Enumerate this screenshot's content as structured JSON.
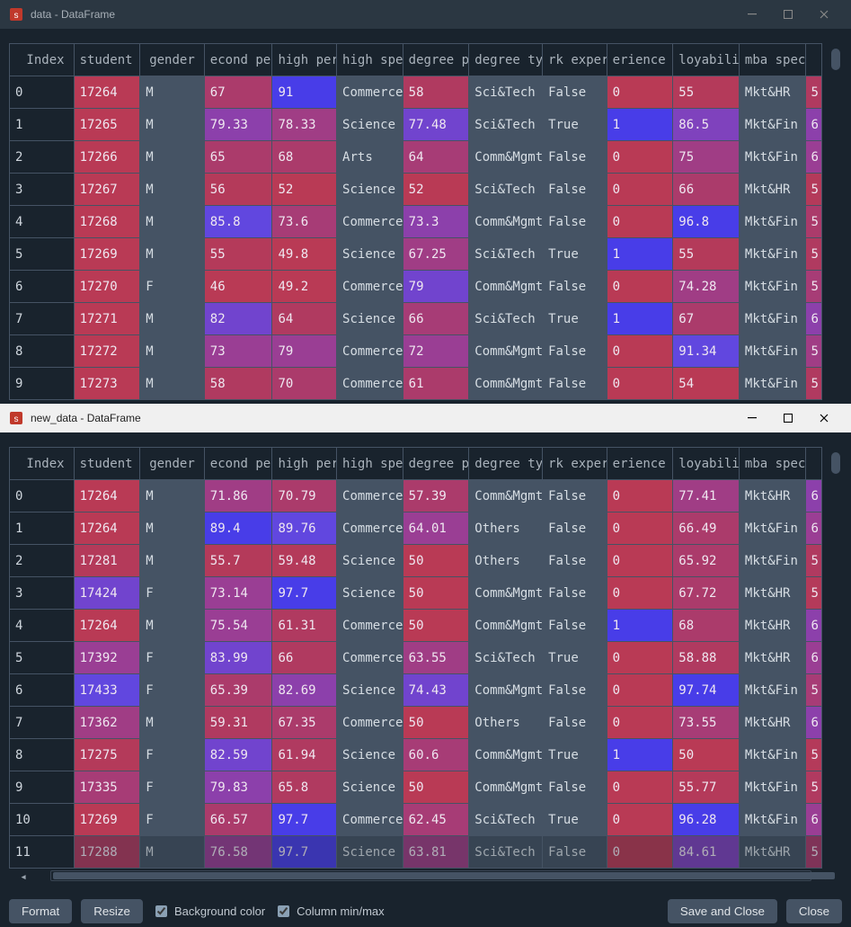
{
  "windows": [
    {
      "title": "data - DataFrame",
      "active": false
    },
    {
      "title": "new_data - DataFrame",
      "active": true
    }
  ],
  "columns": {
    "index": "Index",
    "sid": "student id",
    "gen": "gender",
    "sec": "econd per",
    "hp": "high perc",
    "hs": "high spec",
    "dp": "degree per",
    "dt": "degree type",
    "we": "rk experier",
    "wy": "erience ye",
    "emp": "loyability p",
    "mba": "mba spec",
    "last": ""
  },
  "toolbar": {
    "format": "Format",
    "resize": "Resize",
    "bgcolor": "Background color",
    "minmax": "Column min/max",
    "saveclose": "Save and Close",
    "close": "Close"
  },
  "palette": {
    "crimson1": "#b93a55",
    "crimson2": "#b43a5a",
    "crimson3": "#b03a60",
    "magenta1": "#ab3b6b",
    "magenta2": "#a73c76",
    "magenta3": "#a03d85",
    "purple1": "#9a3e94",
    "purple2": "#8c40ab",
    "purple3": "#7f42bd",
    "violet1": "#7144ce",
    "violet2": "#6147df",
    "indigo": "#483de8",
    "gray": "#455364"
  },
  "data_top": [
    {
      "idx": "0",
      "sid": [
        "17264",
        "crimson1"
      ],
      "gen": "M",
      "sec": [
        "67",
        "magenta1"
      ],
      "hp": [
        "91",
        "indigo"
      ],
      "hs": "Commerce",
      "dp": [
        "58",
        "crimson3"
      ],
      "dt": "Sci&Tech",
      "we": "False",
      "wy": [
        "0",
        "crimson1"
      ],
      "emp": [
        "55",
        "crimson2"
      ],
      "mba": "Mkt&HR",
      "last": [
        "5",
        "crimson3"
      ]
    },
    {
      "idx": "1",
      "sid": [
        "17265",
        "crimson1"
      ],
      "gen": "M",
      "sec": [
        "79.33",
        "purple2"
      ],
      "hp": [
        "78.33",
        "magenta3"
      ],
      "hs": "Science",
      "dp": [
        "77.48",
        "violet1"
      ],
      "dt": "Sci&Tech",
      "we": "True",
      "wy": [
        "1",
        "indigo"
      ],
      "emp": [
        "86.5",
        "purple3"
      ],
      "mba": "Mkt&Fin",
      "last": [
        "6",
        "purple2"
      ]
    },
    {
      "idx": "2",
      "sid": [
        "17266",
        "crimson1"
      ],
      "gen": "M",
      "sec": [
        "65",
        "magenta1"
      ],
      "hp": [
        "68",
        "magenta1"
      ],
      "hs": "Arts",
      "dp": [
        "64",
        "magenta2"
      ],
      "dt": "Comm&Mgmt",
      "we": "False",
      "wy": [
        "0",
        "crimson1"
      ],
      "emp": [
        "75",
        "magenta3"
      ],
      "mba": "Mkt&Fin",
      "last": [
        "6",
        "purple1"
      ]
    },
    {
      "idx": "3",
      "sid": [
        "17267",
        "crimson1"
      ],
      "gen": "M",
      "sec": [
        "56",
        "crimson2"
      ],
      "hp": [
        "52",
        "crimson1"
      ],
      "hs": "Science",
      "dp": [
        "52",
        "crimson1"
      ],
      "dt": "Sci&Tech",
      "we": "False",
      "wy": [
        "0",
        "crimson1"
      ],
      "emp": [
        "66",
        "magenta1"
      ],
      "mba": "Mkt&HR",
      "last": [
        "5",
        "crimson2"
      ]
    },
    {
      "idx": "4",
      "sid": [
        "17268",
        "crimson1"
      ],
      "gen": "M",
      "sec": [
        "85.8",
        "violet2"
      ],
      "hp": [
        "73.6",
        "magenta2"
      ],
      "hs": "Commerce",
      "dp": [
        "73.3",
        "purple2"
      ],
      "dt": "Comm&Mgmt",
      "we": "False",
      "wy": [
        "0",
        "crimson1"
      ],
      "emp": [
        "96.8",
        "indigo"
      ],
      "mba": "Mkt&Fin",
      "last": [
        "5",
        "magenta1"
      ]
    },
    {
      "idx": "5",
      "sid": [
        "17269",
        "crimson1"
      ],
      "gen": "M",
      "sec": [
        "55",
        "crimson2"
      ],
      "hp": [
        "49.8",
        "crimson1"
      ],
      "hs": "Science",
      "dp": [
        "67.25",
        "magenta3"
      ],
      "dt": "Sci&Tech",
      "we": "True",
      "wy": [
        "1",
        "indigo"
      ],
      "emp": [
        "55",
        "crimson2"
      ],
      "mba": "Mkt&Fin",
      "last": [
        "5",
        "crimson3"
      ]
    },
    {
      "idx": "6",
      "sid": [
        "17270",
        "crimson1"
      ],
      "gen": "F",
      "sec": [
        "46",
        "crimson1"
      ],
      "hp": [
        "49.2",
        "crimson1"
      ],
      "hs": "Commerce",
      "dp": [
        "79",
        "violet1"
      ],
      "dt": "Comm&Mgmt",
      "we": "False",
      "wy": [
        "0",
        "crimson1"
      ],
      "emp": [
        "74.28",
        "magenta3"
      ],
      "mba": "Mkt&Fin",
      "last": [
        "5",
        "magenta2"
      ]
    },
    {
      "idx": "7",
      "sid": [
        "17271",
        "crimson1"
      ],
      "gen": "M",
      "sec": [
        "82",
        "violet1"
      ],
      "hp": [
        "64",
        "crimson3"
      ],
      "hs": "Science",
      "dp": [
        "66",
        "magenta2"
      ],
      "dt": "Sci&Tech",
      "we": "True",
      "wy": [
        "1",
        "indigo"
      ],
      "emp": [
        "67",
        "magenta1"
      ],
      "mba": "Mkt&Fin",
      "last": [
        "6",
        "purple2"
      ]
    },
    {
      "idx": "8",
      "sid": [
        "17272",
        "crimson1"
      ],
      "gen": "M",
      "sec": [
        "73",
        "purple1"
      ],
      "hp": [
        "79",
        "purple1"
      ],
      "hs": "Commerce",
      "dp": [
        "72",
        "purple1"
      ],
      "dt": "Comm&Mgmt",
      "we": "False",
      "wy": [
        "0",
        "crimson1"
      ],
      "emp": [
        "91.34",
        "violet2"
      ],
      "mba": "Mkt&Fin",
      "last": [
        "5",
        "magenta3"
      ]
    },
    {
      "idx": "9",
      "sid": [
        "17273",
        "crimson1"
      ],
      "gen": "M",
      "sec": [
        "58",
        "crimson3"
      ],
      "hp": [
        "70",
        "magenta1"
      ],
      "hs": "Commerce",
      "dp": [
        "61",
        "magenta1"
      ],
      "dt": "Comm&Mgmt",
      "we": "False",
      "wy": [
        "0",
        "crimson1"
      ],
      "emp": [
        "54",
        "crimson1"
      ],
      "mba": "Mkt&Fin",
      "last": [
        "5",
        "crimson3"
      ]
    }
  ],
  "data_bottom": [
    {
      "idx": "0",
      "sid": [
        "17264",
        "crimson1"
      ],
      "gen": "M",
      "sec": [
        "71.86",
        "magenta3"
      ],
      "hp": [
        "70.79",
        "magenta1"
      ],
      "hs": "Commerce",
      "dp": [
        "57.39",
        "magenta1"
      ],
      "dt": "Comm&Mgmt",
      "we": "False",
      "wy": [
        "0",
        "crimson1"
      ],
      "emp": [
        "77.41",
        "magenta3"
      ],
      "mba": "Mkt&HR",
      "last": [
        "6",
        "purple2"
      ]
    },
    {
      "idx": "1",
      "sid": [
        "17264",
        "crimson1"
      ],
      "gen": "M",
      "sec": [
        "89.4",
        "indigo"
      ],
      "hp": [
        "89.76",
        "violet2"
      ],
      "hs": "Commerce",
      "dp": [
        "64.01",
        "purple1"
      ],
      "dt": "Others",
      "we": "False",
      "wy": [
        "0",
        "crimson1"
      ],
      "emp": [
        "66.49",
        "magenta1"
      ],
      "mba": "Mkt&Fin",
      "last": [
        "6",
        "purple1"
      ]
    },
    {
      "idx": "2",
      "sid": [
        "17281",
        "crimson2"
      ],
      "gen": "M",
      "sec": [
        "55.7",
        "crimson2"
      ],
      "hp": [
        "59.48",
        "crimson2"
      ],
      "hs": "Science",
      "dp": [
        "50",
        "crimson1"
      ],
      "dt": "Others",
      "we": "False",
      "wy": [
        "0",
        "crimson1"
      ],
      "emp": [
        "65.92",
        "magenta1"
      ],
      "mba": "Mkt&Fin",
      "last": [
        "5",
        "crimson3"
      ]
    },
    {
      "idx": "3",
      "sid": [
        "17424",
        "violet1"
      ],
      "gen": "F",
      "sec": [
        "73.14",
        "purple1"
      ],
      "hp": [
        "97.7",
        "indigo"
      ],
      "hs": "Science",
      "dp": [
        "50",
        "crimson1"
      ],
      "dt": "Comm&Mgmt",
      "we": "False",
      "wy": [
        "0",
        "crimson1"
      ],
      "emp": [
        "67.72",
        "magenta1"
      ],
      "mba": "Mkt&HR",
      "last": [
        "5",
        "crimson2"
      ]
    },
    {
      "idx": "4",
      "sid": [
        "17264",
        "crimson1"
      ],
      "gen": "M",
      "sec": [
        "75.54",
        "purple1"
      ],
      "hp": [
        "61.31",
        "crimson3"
      ],
      "hs": "Commerce",
      "dp": [
        "50",
        "crimson1"
      ],
      "dt": "Comm&Mgmt",
      "we": "False",
      "wy": [
        "1",
        "indigo"
      ],
      "emp": [
        "68",
        "magenta1"
      ],
      "mba": "Mkt&HR",
      "last": [
        "6",
        "purple2"
      ]
    },
    {
      "idx": "5",
      "sid": [
        "17392",
        "purple1"
      ],
      "gen": "F",
      "sec": [
        "83.99",
        "violet1"
      ],
      "hp": [
        "66",
        "crimson3"
      ],
      "hs": "Commerce",
      "dp": [
        "63.55",
        "magenta3"
      ],
      "dt": "Sci&Tech",
      "we": "True",
      "wy": [
        "0",
        "crimson1"
      ],
      "emp": [
        "58.88",
        "crimson3"
      ],
      "mba": "Mkt&HR",
      "last": [
        "6",
        "purple1"
      ]
    },
    {
      "idx": "6",
      "sid": [
        "17433",
        "violet2"
      ],
      "gen": "F",
      "sec": [
        "65.39",
        "magenta1"
      ],
      "hp": [
        "82.69",
        "purple2"
      ],
      "hs": "Science",
      "dp": [
        "74.43",
        "violet1"
      ],
      "dt": "Comm&Mgmt",
      "we": "False",
      "wy": [
        "0",
        "crimson1"
      ],
      "emp": [
        "97.74",
        "indigo"
      ],
      "mba": "Mkt&Fin",
      "last": [
        "5",
        "magenta2"
      ]
    },
    {
      "idx": "7",
      "sid": [
        "17362",
        "magenta3"
      ],
      "gen": "M",
      "sec": [
        "59.31",
        "crimson3"
      ],
      "hp": [
        "67.35",
        "magenta1"
      ],
      "hs": "Commerce",
      "dp": [
        "50",
        "crimson1"
      ],
      "dt": "Others",
      "we": "False",
      "wy": [
        "0",
        "crimson1"
      ],
      "emp": [
        "73.55",
        "magenta2"
      ],
      "mba": "Mkt&HR",
      "last": [
        "6",
        "purple2"
      ]
    },
    {
      "idx": "8",
      "sid": [
        "17275",
        "crimson2"
      ],
      "gen": "F",
      "sec": [
        "82.59",
        "violet1"
      ],
      "hp": [
        "61.94",
        "crimson3"
      ],
      "hs": "Science",
      "dp": [
        "60.6",
        "magenta2"
      ],
      "dt": "Comm&Mgmt",
      "we": "True",
      "wy": [
        "1",
        "indigo"
      ],
      "emp": [
        "50",
        "crimson1"
      ],
      "mba": "Mkt&Fin",
      "last": [
        "5",
        "crimson2"
      ]
    },
    {
      "idx": "9",
      "sid": [
        "17335",
        "magenta2"
      ],
      "gen": "F",
      "sec": [
        "79.83",
        "purple2"
      ],
      "hp": [
        "65.8",
        "crimson3"
      ],
      "hs": "Science",
      "dp": [
        "50",
        "crimson1"
      ],
      "dt": "Comm&Mgmt",
      "we": "False",
      "wy": [
        "0",
        "crimson1"
      ],
      "emp": [
        "55.77",
        "crimson2"
      ],
      "mba": "Mkt&Fin",
      "last": [
        "5",
        "crimson3"
      ]
    },
    {
      "idx": "10",
      "sid": [
        "17269",
        "crimson1"
      ],
      "gen": "F",
      "sec": [
        "66.57",
        "magenta1"
      ],
      "hp": [
        "97.7",
        "indigo"
      ],
      "hs": "Commerce",
      "dp": [
        "62.45",
        "magenta2"
      ],
      "dt": "Sci&Tech",
      "we": "True",
      "wy": [
        "0",
        "crimson1"
      ],
      "emp": [
        "96.28",
        "indigo"
      ],
      "mba": "Mkt&Fin",
      "last": [
        "6",
        "purple1"
      ]
    },
    {
      "idx": "11",
      "sid": [
        "17288",
        "crimson3"
      ],
      "gen": "M",
      "sec": [
        "76.58",
        "purple1"
      ],
      "hp": [
        "97.7",
        "indigo"
      ],
      "hs": "Science",
      "dp": [
        "63.81",
        "magenta3"
      ],
      "dt": "Sci&Tech",
      "we": "False",
      "wy": [
        "0",
        "crimson1"
      ],
      "emp": [
        "84.61",
        "purple3"
      ],
      "mba": "Mkt&HR",
      "last": [
        "5",
        "magenta1"
      ],
      "clip": true
    }
  ]
}
